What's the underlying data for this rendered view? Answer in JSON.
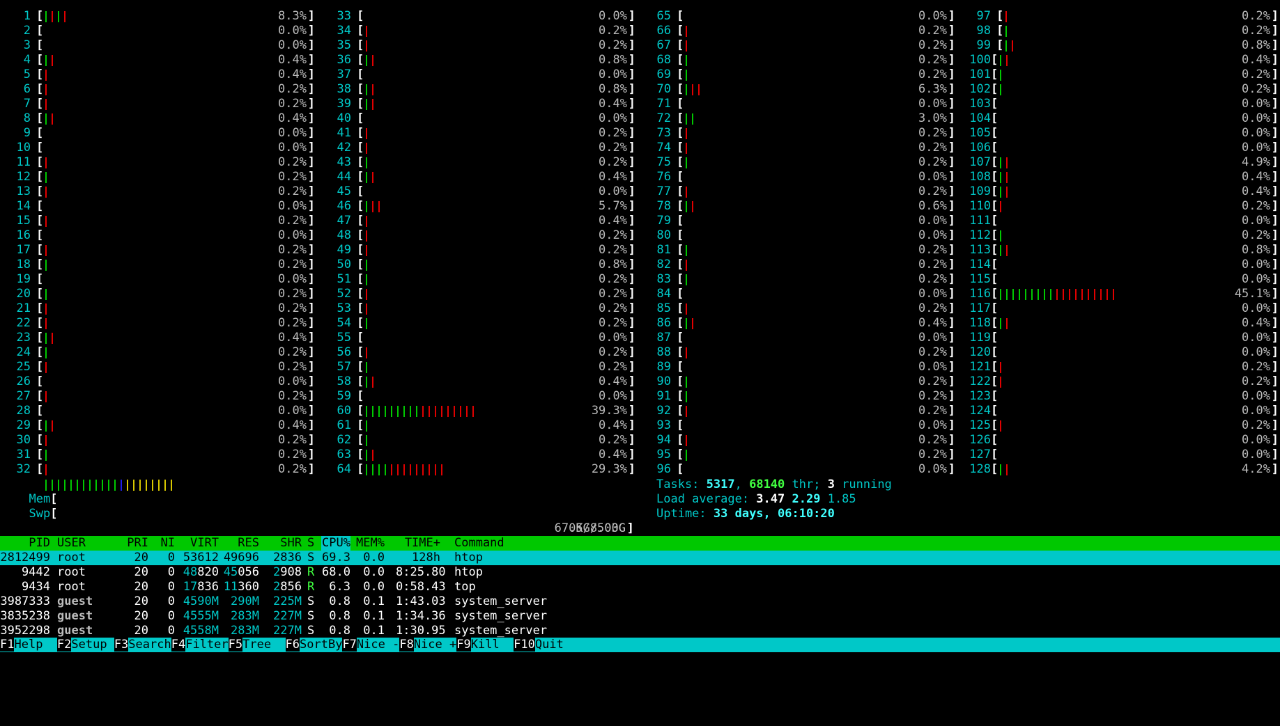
{
  "colors": {
    "cyan": "#00c8c8",
    "green": "#00c800",
    "red": "#e00000",
    "blue": "#2020e8",
    "yellow": "#d8c800"
  },
  "cpus": [
    [
      "1",
      "grgr",
      "8.3%"
    ],
    [
      "2",
      "",
      "0.0%"
    ],
    [
      "3",
      "",
      "0.0%"
    ],
    [
      "4",
      "gr",
      "0.4%"
    ],
    [
      "5",
      "r",
      "0.4%"
    ],
    [
      "6",
      "r",
      "0.2%"
    ],
    [
      "7",
      "r",
      "0.2%"
    ],
    [
      "8",
      "gr",
      "0.4%"
    ],
    [
      "9",
      "",
      "0.0%"
    ],
    [
      "10",
      "",
      "0.0%"
    ],
    [
      "11",
      "r",
      "0.2%"
    ],
    [
      "12",
      "g",
      "0.2%"
    ],
    [
      "13",
      "r",
      "0.2%"
    ],
    [
      "14",
      "",
      "0.0%"
    ],
    [
      "15",
      "r",
      "0.2%"
    ],
    [
      "16",
      "",
      "0.0%"
    ],
    [
      "17",
      "r",
      "0.2%"
    ],
    [
      "18",
      "g",
      "0.2%"
    ],
    [
      "19",
      "",
      "0.0%"
    ],
    [
      "20",
      "g",
      "0.2%"
    ],
    [
      "21",
      "r",
      "0.2%"
    ],
    [
      "22",
      "r",
      "0.2%"
    ],
    [
      "23",
      "gr",
      "0.4%"
    ],
    [
      "24",
      "g",
      "0.2%"
    ],
    [
      "25",
      "r",
      "0.2%"
    ],
    [
      "26",
      "",
      "0.0%"
    ],
    [
      "27",
      "r",
      "0.2%"
    ],
    [
      "28",
      "",
      "0.0%"
    ],
    [
      "29",
      "gr",
      "0.4%"
    ],
    [
      "30",
      "r",
      "0.2%"
    ],
    [
      "31",
      "g",
      "0.2%"
    ],
    [
      "32",
      "r",
      "0.2%"
    ],
    [
      "33",
      "",
      "0.0%"
    ],
    [
      "34",
      "r",
      "0.2%"
    ],
    [
      "35",
      "r",
      "0.2%"
    ],
    [
      "36",
      "gr",
      "0.8%"
    ],
    [
      "37",
      "",
      "0.0%"
    ],
    [
      "38",
      "gr",
      "0.8%"
    ],
    [
      "39",
      "gr",
      "0.4%"
    ],
    [
      "40",
      "",
      "0.0%"
    ],
    [
      "41",
      "r",
      "0.2%"
    ],
    [
      "42",
      "r",
      "0.2%"
    ],
    [
      "43",
      "g",
      "0.2%"
    ],
    [
      "44",
      "gr",
      "0.4%"
    ],
    [
      "45",
      "",
      "0.0%"
    ],
    [
      "46",
      "grr",
      "5.7%"
    ],
    [
      "47",
      "r",
      "0.4%"
    ],
    [
      "48",
      "r",
      "0.2%"
    ],
    [
      "49",
      "r",
      "0.2%"
    ],
    [
      "50",
      "g",
      "0.8%"
    ],
    [
      "51",
      "g",
      "0.2%"
    ],
    [
      "52",
      "r",
      "0.2%"
    ],
    [
      "53",
      "r",
      "0.2%"
    ],
    [
      "54",
      "g",
      "0.2%"
    ],
    [
      "55",
      "",
      "0.0%"
    ],
    [
      "56",
      "r",
      "0.2%"
    ],
    [
      "57",
      "g",
      "0.2%"
    ],
    [
      "58",
      "gr",
      "0.4%"
    ],
    [
      "59",
      "",
      "0.0%"
    ],
    [
      "60",
      "gggggggggrrrrrrrrr",
      "39.3%"
    ],
    [
      "61",
      "g",
      "0.4%"
    ],
    [
      "62",
      "g",
      "0.2%"
    ],
    [
      "63",
      "gr",
      "0.4%"
    ],
    [
      "64",
      "ggggrrrrrrrrr",
      "29.3%"
    ],
    [
      "65",
      "",
      "0.0%"
    ],
    [
      "66",
      "r",
      "0.2%"
    ],
    [
      "67",
      "r",
      "0.2%"
    ],
    [
      "68",
      "g",
      "0.2%"
    ],
    [
      "69",
      "g",
      "0.2%"
    ],
    [
      "70",
      "grr",
      "6.3%"
    ],
    [
      "71",
      "",
      "0.0%"
    ],
    [
      "72",
      "gg",
      "3.0%"
    ],
    [
      "73",
      "r",
      "0.2%"
    ],
    [
      "74",
      "r",
      "0.2%"
    ],
    [
      "75",
      "g",
      "0.2%"
    ],
    [
      "76",
      "",
      "0.0%"
    ],
    [
      "77",
      "r",
      "0.2%"
    ],
    [
      "78",
      "gr",
      "0.6%"
    ],
    [
      "79",
      "",
      "0.0%"
    ],
    [
      "80",
      "",
      "0.0%"
    ],
    [
      "81",
      "g",
      "0.2%"
    ],
    [
      "82",
      "r",
      "0.2%"
    ],
    [
      "83",
      "g",
      "0.2%"
    ],
    [
      "84",
      "",
      "0.0%"
    ],
    [
      "85",
      "r",
      "0.2%"
    ],
    [
      "86",
      "gr",
      "0.4%"
    ],
    [
      "87",
      "",
      "0.0%"
    ],
    [
      "88",
      "r",
      "0.2%"
    ],
    [
      "89",
      "",
      "0.0%"
    ],
    [
      "90",
      "g",
      "0.2%"
    ],
    [
      "91",
      "g",
      "0.2%"
    ],
    [
      "92",
      "r",
      "0.2%"
    ],
    [
      "93",
      "",
      "0.0%"
    ],
    [
      "94",
      "r",
      "0.2%"
    ],
    [
      "95",
      "g",
      "0.2%"
    ],
    [
      "96",
      "",
      "0.0%"
    ],
    [
      "97",
      "r",
      "0.2%"
    ],
    [
      "98",
      "g",
      "0.2%"
    ],
    [
      "99",
      "gr",
      "0.8%"
    ],
    [
      "100",
      "gr",
      "0.4%"
    ],
    [
      "101",
      "g",
      "0.2%"
    ],
    [
      "102",
      "g",
      "0.2%"
    ],
    [
      "103",
      "",
      "0.0%"
    ],
    [
      "104",
      "",
      "0.0%"
    ],
    [
      "105",
      "",
      "0.0%"
    ],
    [
      "106",
      "",
      "0.0%"
    ],
    [
      "107",
      "gr",
      "4.9%"
    ],
    [
      "108",
      "gr",
      "0.4%"
    ],
    [
      "109",
      "gr",
      "0.4%"
    ],
    [
      "110",
      "r",
      "0.2%"
    ],
    [
      "111",
      "",
      "0.0%"
    ],
    [
      "112",
      "g",
      "0.2%"
    ],
    [
      "113",
      "gr",
      "0.8%"
    ],
    [
      "114",
      "",
      "0.0%"
    ],
    [
      "115",
      "",
      "0.0%"
    ],
    [
      "116",
      "gggggggggrrrrrrrrrr",
      "45.1%"
    ],
    [
      "117",
      "",
      "0.0%"
    ],
    [
      "118",
      "gr",
      "0.4%"
    ],
    [
      "119",
      "",
      "0.0%"
    ],
    [
      "120",
      "",
      "0.0%"
    ],
    [
      "121",
      "r",
      "0.2%"
    ],
    [
      "122",
      "r",
      "0.2%"
    ],
    [
      "123",
      "",
      "0.0%"
    ],
    [
      "124",
      "",
      "0.0%"
    ],
    [
      "125",
      "r",
      "0.2%"
    ],
    [
      "126",
      "",
      "0.0%"
    ],
    [
      "127",
      "",
      "0.0%"
    ],
    [
      "128",
      "gr",
      "4.2%"
    ]
  ],
  "mem": {
    "label": "Mem",
    "bar": "ggggggggggggbyyyyyyyy",
    "value": "67.5G/503G"
  },
  "swp": {
    "label": "Swp",
    "value": "0K/8.00G"
  },
  "tasks": {
    "label": "Tasks: ",
    "count": "5317",
    "sep": ", ",
    "threads": "68140",
    "thr_label": " thr; ",
    "running": "3",
    "running_label": " running"
  },
  "load": {
    "label": "Load average: ",
    "l1": "3.47",
    "l5": "2.29",
    "l15": "1.85"
  },
  "uptime": {
    "label": "Uptime: ",
    "value": "33 days, 06:10:20"
  },
  "columns": {
    "pid": "PID",
    "user": "USER",
    "pri": "PRI",
    "ni": "NI",
    "virt": "VIRT",
    "res": "RES",
    "shr": "SHR",
    "s": "S",
    "cpu": "CPU%",
    "mem": "MEM%",
    "time": "TIME+",
    "cmd": "Command"
  },
  "processes": [
    {
      "pid": "2812499",
      "user": "root",
      "pri": "20",
      "ni": "0",
      "virt": "53612",
      "res": "49696",
      "shr": "2836",
      "s": "S",
      "cpu": "69.3",
      "mem": "0.0",
      "time": "128h",
      "cmd": "htop"
    },
    {
      "pid": "9442",
      "user": "root",
      "pri": "20",
      "ni": "0",
      "virt": "48820",
      "res": "45056",
      "shr": "2908",
      "s": "R",
      "cpu": "68.0",
      "mem": "0.0",
      "time": "8:25.80",
      "cmd": "htop"
    },
    {
      "pid": "9434",
      "user": "root",
      "pri": "20",
      "ni": "0",
      "virt": "17836",
      "res": "11360",
      "shr": "2856",
      "s": "R",
      "cpu": "6.3",
      "mem": "0.0",
      "time": "0:58.43",
      "cmd": "top"
    },
    {
      "pid": "3987333",
      "user": "guest",
      "pri": "20",
      "ni": "0",
      "virt": "4590M",
      "res": "290M",
      "shr": "225M",
      "s": "S",
      "cpu": "0.8",
      "mem": "0.1",
      "time": "1:43.03",
      "cmd": "system_server"
    },
    {
      "pid": "3835238",
      "user": "guest",
      "pri": "20",
      "ni": "0",
      "virt": "4555M",
      "res": "283M",
      "shr": "227M",
      "s": "S",
      "cpu": "0.8",
      "mem": "0.1",
      "time": "1:34.36",
      "cmd": "system_server"
    },
    {
      "pid": "3952298",
      "user": "guest",
      "pri": "20",
      "ni": "0",
      "virt": "4558M",
      "res": "283M",
      "shr": "227M",
      "s": "S",
      "cpu": "0.8",
      "mem": "0.1",
      "time": "1:30.95",
      "cmd": "system_server"
    }
  ],
  "footer": [
    {
      "key": "F1",
      "label": "Help  "
    },
    {
      "key": "F2",
      "label": "Setup "
    },
    {
      "key": "F3",
      "label": "Search"
    },
    {
      "key": "F4",
      "label": "Filter"
    },
    {
      "key": "F5",
      "label": "Tree  "
    },
    {
      "key": "F6",
      "label": "SortBy"
    },
    {
      "key": "F7",
      "label": "Nice -"
    },
    {
      "key": "F8",
      "label": "Nice +"
    },
    {
      "key": "F9",
      "label": "Kill  "
    },
    {
      "key": "F10",
      "label": "Quit"
    }
  ]
}
